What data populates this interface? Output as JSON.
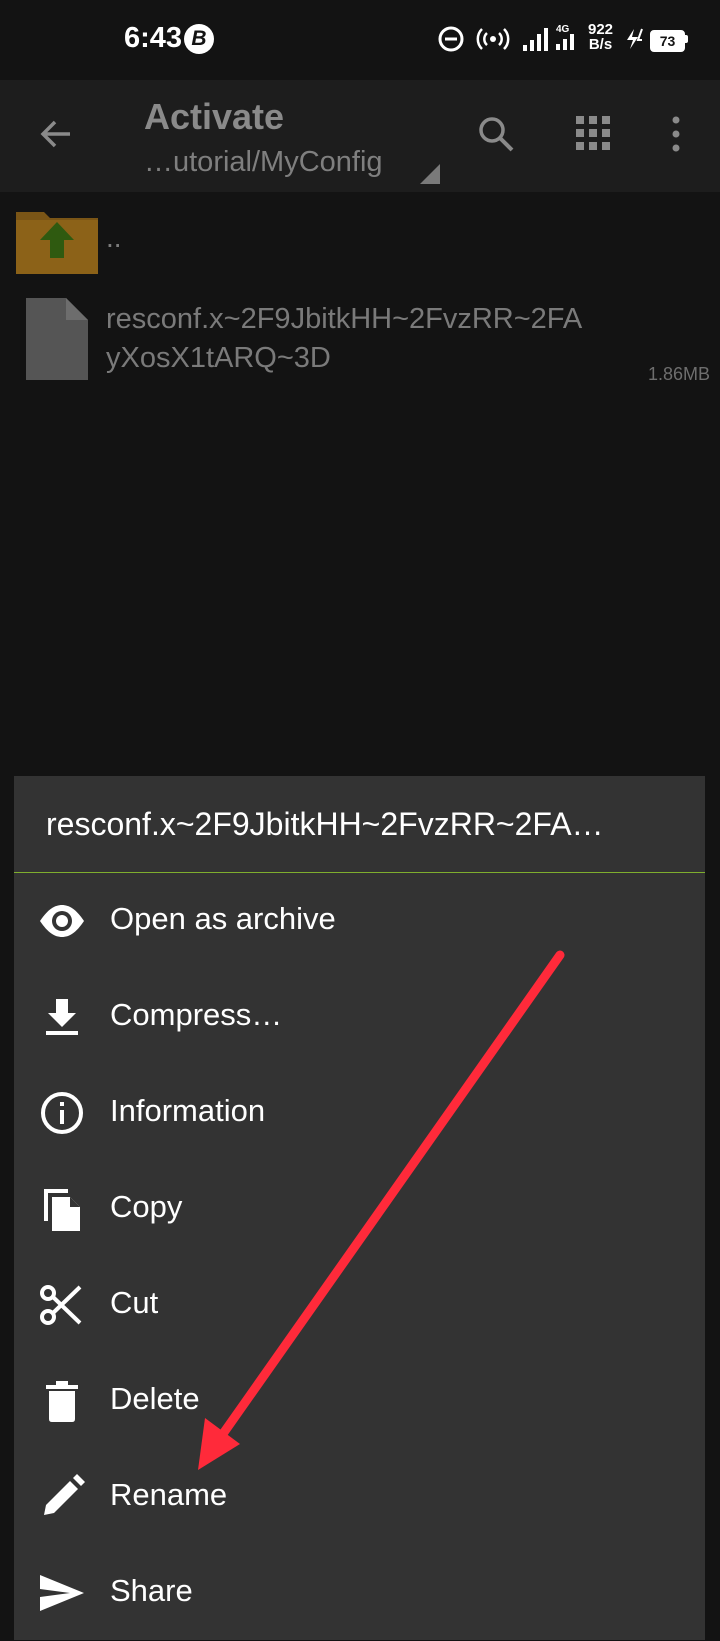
{
  "status_bar": {
    "time": "6:43",
    "b_badge": "B",
    "net_speed_value": "922",
    "net_speed_unit": "B/s",
    "network_type": "4G",
    "battery": "73"
  },
  "toolbar": {
    "title": "Activate",
    "path": "…utorial/MyConfig"
  },
  "files": {
    "parent_label": "..",
    "file_name": "resconf.x~2F9JbitkHH~2FvzRR~2FA yXosX1tARQ~3D",
    "file_size": "1.86MB"
  },
  "sheet": {
    "title": "resconf.x~2F9JbitkHH~2FvzRR~2FA…",
    "items": [
      {
        "label": "Open as archive",
        "icon": "eye-icon"
      },
      {
        "label": "Compress…",
        "icon": "download-icon"
      },
      {
        "label": "Information",
        "icon": "info-icon"
      },
      {
        "label": "Copy",
        "icon": "copy-icon"
      },
      {
        "label": "Cut",
        "icon": "scissors-icon"
      },
      {
        "label": "Delete",
        "icon": "trash-icon"
      },
      {
        "label": "Rename",
        "icon": "pencil-icon"
      },
      {
        "label": "Share",
        "icon": "send-icon"
      }
    ]
  },
  "colors": {
    "background": "#131313",
    "sheet": "#333333",
    "divider_accent": "#7fae2e",
    "annotation_arrow": "#ff2a3a",
    "folder": "#b07a1e",
    "folder_arrow": "#3a6b12"
  }
}
